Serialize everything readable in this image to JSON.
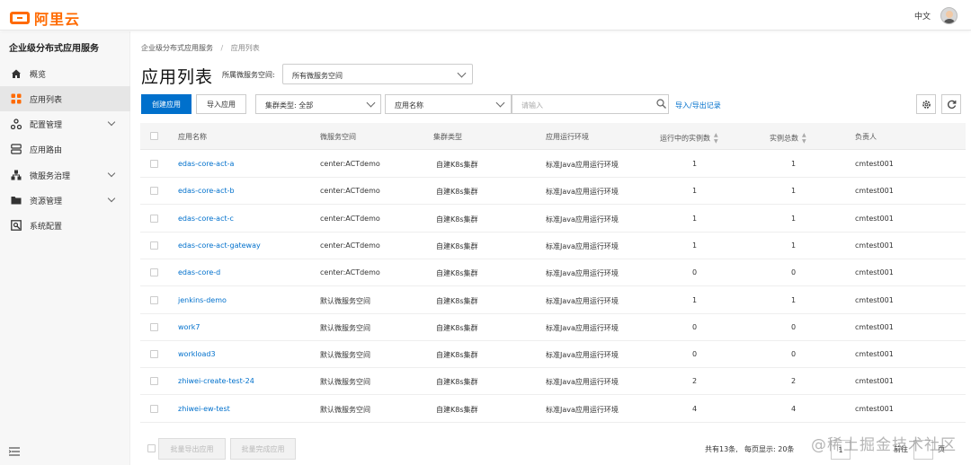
{
  "header": {
    "logo_text": "阿里云",
    "language": "中文",
    "brand_color": "#ff6a00"
  },
  "sidebar": {
    "title": "企业级分布式应用服务",
    "items": [
      {
        "label": "概览",
        "icon": "home-icon",
        "expandable": false,
        "active": false
      },
      {
        "label": "应用列表",
        "icon": "grid-icon",
        "expandable": false,
        "active": true
      },
      {
        "label": "配置管理",
        "icon": "config-icon",
        "expandable": true,
        "active": false
      },
      {
        "label": "应用路由",
        "icon": "route-icon",
        "expandable": false,
        "active": false
      },
      {
        "label": "微服务治理",
        "icon": "microservice-icon",
        "expandable": true,
        "active": false
      },
      {
        "label": "资源管理",
        "icon": "folder-icon",
        "expandable": true,
        "active": false
      },
      {
        "label": "系统配置",
        "icon": "system-config-icon",
        "expandable": false,
        "active": false
      }
    ],
    "bottom_icon": "menu-collapse-icon"
  },
  "breadcrumb": {
    "parent": "企业级分布式应用服务",
    "separator": "/",
    "current": "应用列表"
  },
  "page": {
    "title": "应用列表",
    "namespace_label": "所属微服务空间:",
    "namespace_value": "所有微服务空间"
  },
  "toolbar": {
    "create_label": "创建应用",
    "import_label": "导入应用",
    "cluster_filter": "集群类型: 全部",
    "search_field": "应用名称",
    "search_placeholder": "请输入",
    "import_export_link": "导入/导出记录",
    "accent_color": "#0070cc"
  },
  "table": {
    "columns": [
      "应用名称",
      "微服务空间",
      "集群类型",
      "应用运行环境",
      "运行中的实例数",
      "实例总数",
      "负责人"
    ],
    "rows": [
      [
        "edas-core-act-a",
        "center:ACTdemo",
        "自建K8s集群",
        "标准Java应用运行环境",
        "1",
        "1",
        "cmtest001"
      ],
      [
        "edas-core-act-b",
        "center:ACTdemo",
        "自建K8s集群",
        "标准Java应用运行环境",
        "1",
        "1",
        "cmtest001"
      ],
      [
        "edas-core-act-c",
        "center:ACTdemo",
        "自建K8s集群",
        "标准Java应用运行环境",
        "1",
        "1",
        "cmtest001"
      ],
      [
        "edas-core-act-gateway",
        "center:ACTdemo",
        "自建K8s集群",
        "标准Java应用运行环境",
        "1",
        "1",
        "cmtest001"
      ],
      [
        "edas-core-d",
        "center:ACTdemo",
        "自建K8s集群",
        "标准Java应用运行环境",
        "0",
        "0",
        "cmtest001"
      ],
      [
        "jenkins-demo",
        "默认微服务空间",
        "自建K8s集群",
        "标准Java应用运行环境",
        "1",
        "1",
        "cmtest001"
      ],
      [
        "work7",
        "默认微服务空间",
        "自建K8s集群",
        "标准Java应用运行环境",
        "0",
        "0",
        "cmtest001"
      ],
      [
        "workload3",
        "默认微服务空间",
        "自建K8s集群",
        "标准Java应用运行环境",
        "0",
        "0",
        "cmtest001"
      ],
      [
        "zhiwei-create-test-24",
        "默认微服务空间",
        "自建K8s集群",
        "标准Java应用运行环境",
        "2",
        "2",
        "cmtest001"
      ],
      [
        "zhiwei-ew-test",
        "默认微服务空间",
        "自建K8s集群",
        "标准Java应用运行环境",
        "4",
        "4",
        "cmtest001"
      ]
    ]
  },
  "footer": {
    "batch_export": "批量导出应用",
    "batch_deploy": "批量完成应用",
    "total": "共有13条,",
    "per_page": "每页显示: 20条",
    "page_num": "1",
    "goto": "前往",
    "page_unit": "页"
  },
  "watermark": "@稀土掘金技术社区"
}
